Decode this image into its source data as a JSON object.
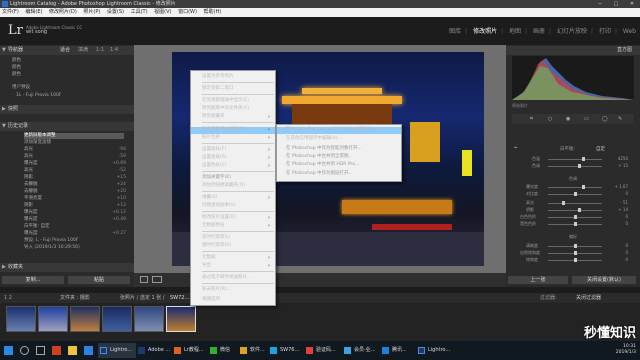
{
  "titlebar": {
    "title": "Lightroom Catalog - Adobe Photoshop Lightroom Classic - 修改照片"
  },
  "menubar": [
    "文件(F)",
    "编辑(E)",
    "修改照片(D)",
    "照片(P)",
    "设置(S)",
    "工具(T)",
    "视图(V)",
    "窗口(W)",
    "帮助(H)"
  ],
  "identity": {
    "product": "Adobe Lightroom Classic CC",
    "user": "wit song"
  },
  "modules": [
    "图库",
    "修改照片",
    "地图",
    "画册",
    "幻灯片放映",
    "打印",
    "Web"
  ],
  "active_module": "修改照片",
  "left": {
    "navigator": "导航器",
    "fit": "适合",
    "zoom1": "填满",
    "zoom2": "1:1",
    "zoom3": "1:4",
    "presets": [
      "颜色",
      "颜色",
      "颜色",
      "用户预设",
      "1L - Fuji Provia 100F"
    ],
    "snapshots": "快照",
    "history": "历史记录",
    "history_items": [
      {
        "label": "更新旧版本调整",
        "val": "",
        "sel": true
      },
      {
        "label": "添加渐变滤镜",
        "val": ""
      },
      {
        "label": "高光",
        "val": "-94"
      },
      {
        "label": "高光",
        "val": "-59"
      },
      {
        "label": "曝光度",
        "val": "+0.69"
      },
      {
        "label": "高光",
        "val": "-52"
      },
      {
        "label": "阴影",
        "val": "+15"
      },
      {
        "label": "去朦胧",
        "val": "+24"
      },
      {
        "label": "去朦胧",
        "val": "+20"
      },
      {
        "label": "平滑亮度",
        "val": "+10"
      },
      {
        "label": "阴影",
        "val": "+12"
      },
      {
        "label": "曝光度",
        "val": "+0.12"
      },
      {
        "label": "曝光度",
        "val": "+0.49"
      },
      {
        "label": "白平衡: 自定",
        "val": ""
      },
      {
        "label": "曝光度",
        "val": "+0.27"
      },
      {
        "label": "预设: L - Fuji Provia 100F",
        "val": ""
      },
      {
        "label": "导入 (2019/1/3 10:29:56)",
        "val": ""
      }
    ],
    "collections": "收藏夹",
    "copy": "复制...",
    "paste": "粘贴"
  },
  "right": {
    "histogram": "直方图",
    "original_photo": "原始照片",
    "basic_label": "自定",
    "treatment": "颜色",
    "wb": "白平衡:",
    "temp": "色温",
    "tint": "色调",
    "tone": "色调",
    "exposure": "曝光度",
    "contrast": "对比度",
    "highlights": "高光",
    "shadows": "阴影",
    "whites": "白色色阶",
    "blacks": "黑色色阶",
    "presence": "偏好",
    "clarity": "清晰度",
    "vibrance": "自然饱和度",
    "saturation": "饱和度",
    "values": {
      "temp": "4250",
      "tint": "+ 15",
      "exposure": "+ 1.07",
      "contrast": "0",
      "highlights": "- 51",
      "shadows": "+ 14",
      "whites": "0",
      "blacks": "0",
      "clarity": "0",
      "vibrance": "0",
      "saturation": "0"
    },
    "prev": "上一张",
    "reset": "关闭设置(默认)"
  },
  "filmstrip": {
    "nav": "1 2",
    "label": "文件夹 : 摄影",
    "count": "张照片 / 选定 1 张 /",
    "filename": "SW72...",
    "filter": "过滤器:",
    "filter_val": "关闭过滤器"
  },
  "context_menu": [
    {
      "label": "设置为参考照片",
      "dis": false,
      "arrow": false
    },
    {
      "label": "锁定到第二窗口",
      "dis": false,
      "arrow": false
    },
    {
      "label": "在资源管理器中显示(E)",
      "dis": false,
      "arrow": false
    },
    {
      "label": "转到图库中的文件夹(V)",
      "dis": false,
      "arrow": false
    },
    {
      "label": "转到收藏夹",
      "dis": false,
      "arrow": true
    },
    {
      "label": "在应用程序中编辑(E)",
      "dis": false,
      "arrow": true,
      "hl": true
    },
    {
      "label": "照片合并",
      "dis": false,
      "arrow": true
    },
    {
      "label": "设置旗标(F)",
      "dis": false,
      "arrow": true
    },
    {
      "label": "设置星级(R)",
      "dis": false,
      "arrow": true
    },
    {
      "label": "设置色标(C)",
      "dis": false,
      "arrow": true
    },
    {
      "label": "添加关键字(K)",
      "dis": true,
      "arrow": false
    },
    {
      "label": "添加到快捷收藏夹(Q)",
      "dis": false,
      "arrow": false
    },
    {
      "label": "堆叠(S)",
      "dis": false,
      "arrow": true
    },
    {
      "label": "创建虚拟副本(V)",
      "dis": false,
      "arrow": false
    },
    {
      "label": "修改照片设置(D)",
      "dis": false,
      "arrow": true
    },
    {
      "label": "元数据预设",
      "dis": false,
      "arrow": true
    },
    {
      "label": "逆时针旋转(L)",
      "dis": false,
      "arrow": false
    },
    {
      "label": "顺时针旋转(R)",
      "dis": false,
      "arrow": false
    },
    {
      "label": "元数据",
      "dis": false,
      "arrow": true
    },
    {
      "label": "导出",
      "dis": false,
      "arrow": true
    },
    {
      "label": "通过电子邮件发送照片...",
      "dis": false,
      "arrow": false
    },
    {
      "label": "移去照片(R)...",
      "dis": false,
      "arrow": false
    },
    {
      "label": "视图选项",
      "dis": false,
      "arrow": false
    }
  ],
  "submenu": [
    {
      "label": "在 Adobe Photoshop CC 2019 中编辑(E)...",
      "dis": false,
      "hl": true
    },
    {
      "label": "在其他应用程序中编辑(A)...",
      "dis": false
    },
    {
      "label": "在 Photoshop 中作为智能对象打开...",
      "dis": true
    },
    {
      "label": "在 Photoshop 中合并到全景图...",
      "dis": true
    },
    {
      "label": "在 Photoshop 中合并到 HDR Pro...",
      "dis": true
    },
    {
      "label": "在 Photoshop 中作为图层打开...",
      "dis": true
    }
  ],
  "taskbar": [
    "Lightro...",
    "Adobe ...",
    "Lr教程...",
    "微信",
    "软件...",
    "SW76...",
    "验证码...",
    "会员-业...",
    "腾讯...",
    "Lightro..."
  ],
  "clock": {
    "time": "10:31",
    "date": "2019/1/3"
  },
  "watermark": "秒懂知识"
}
